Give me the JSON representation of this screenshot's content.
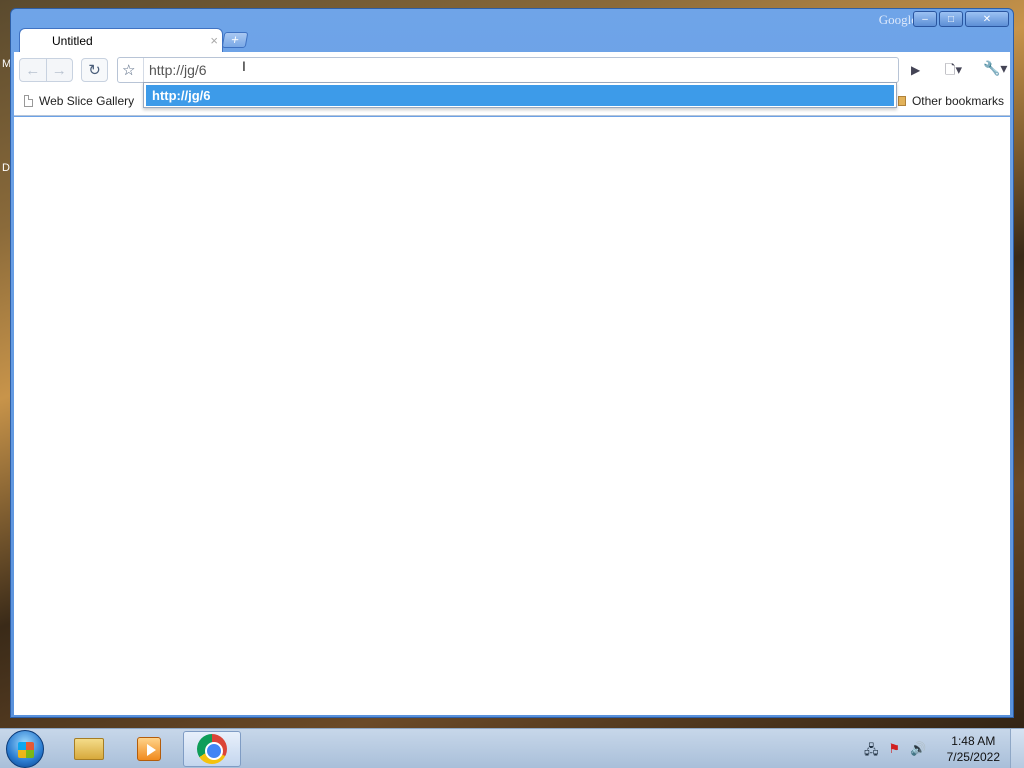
{
  "desktop": {
    "edge_letters": [
      "M",
      "D"
    ]
  },
  "window": {
    "brand": "Google",
    "controls": {
      "minimize": "–",
      "maximize": "□",
      "close": "✕"
    }
  },
  "tabs": [
    {
      "title": "Untitled",
      "close": "×"
    }
  ],
  "new_tab_label": "+",
  "toolbar": {
    "back": "←",
    "forward": "→",
    "reload": "↻",
    "star": "☆",
    "omnibox_value": "http://jg/6",
    "go": "▶",
    "page_menu": "🗋▾",
    "tools_menu": "🔧▾"
  },
  "autocomplete": {
    "suggestions": [
      "http://jg/6"
    ]
  },
  "bookmarks": {
    "items": [
      {
        "label": "Web Slice Gallery",
        "icon": "page-icon"
      }
    ],
    "other": "Other bookmarks"
  },
  "taskbar": {
    "apps": [
      {
        "name": "Windows Explorer",
        "icon": "folder-icon",
        "active": false
      },
      {
        "name": "Windows Media Player",
        "icon": "media-player-icon",
        "active": false
      },
      {
        "name": "Google Chrome",
        "icon": "chrome-icon",
        "active": true
      }
    ],
    "tray_icons": [
      "network-icon",
      "action-center-icon",
      "volume-icon"
    ],
    "time": "1:48 AM",
    "date": "7/25/2022"
  }
}
